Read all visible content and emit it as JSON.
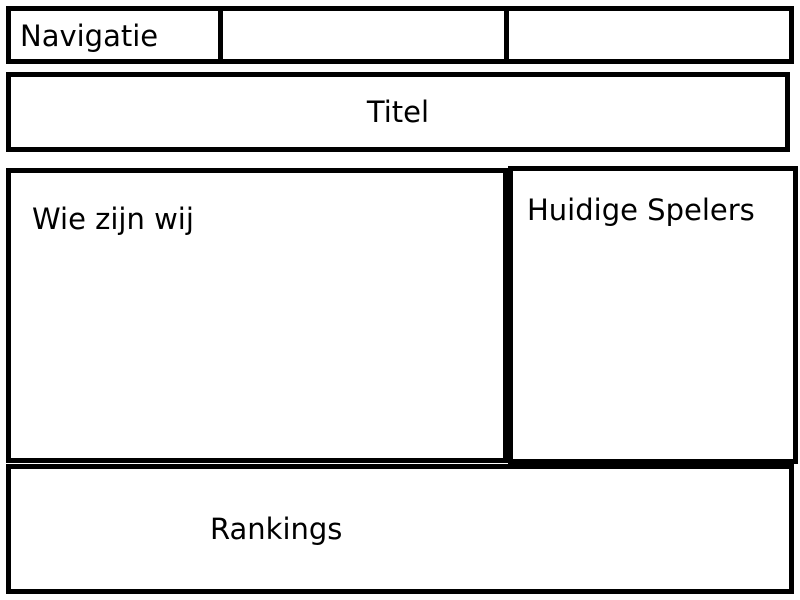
{
  "navigation": {
    "label": "Navigatie"
  },
  "header": {
    "title": "Titel"
  },
  "main": {
    "about_heading": "Wie zijn wij",
    "players_heading": "Huidige Spelers"
  },
  "footer": {
    "rankings_heading": "Rankings"
  }
}
